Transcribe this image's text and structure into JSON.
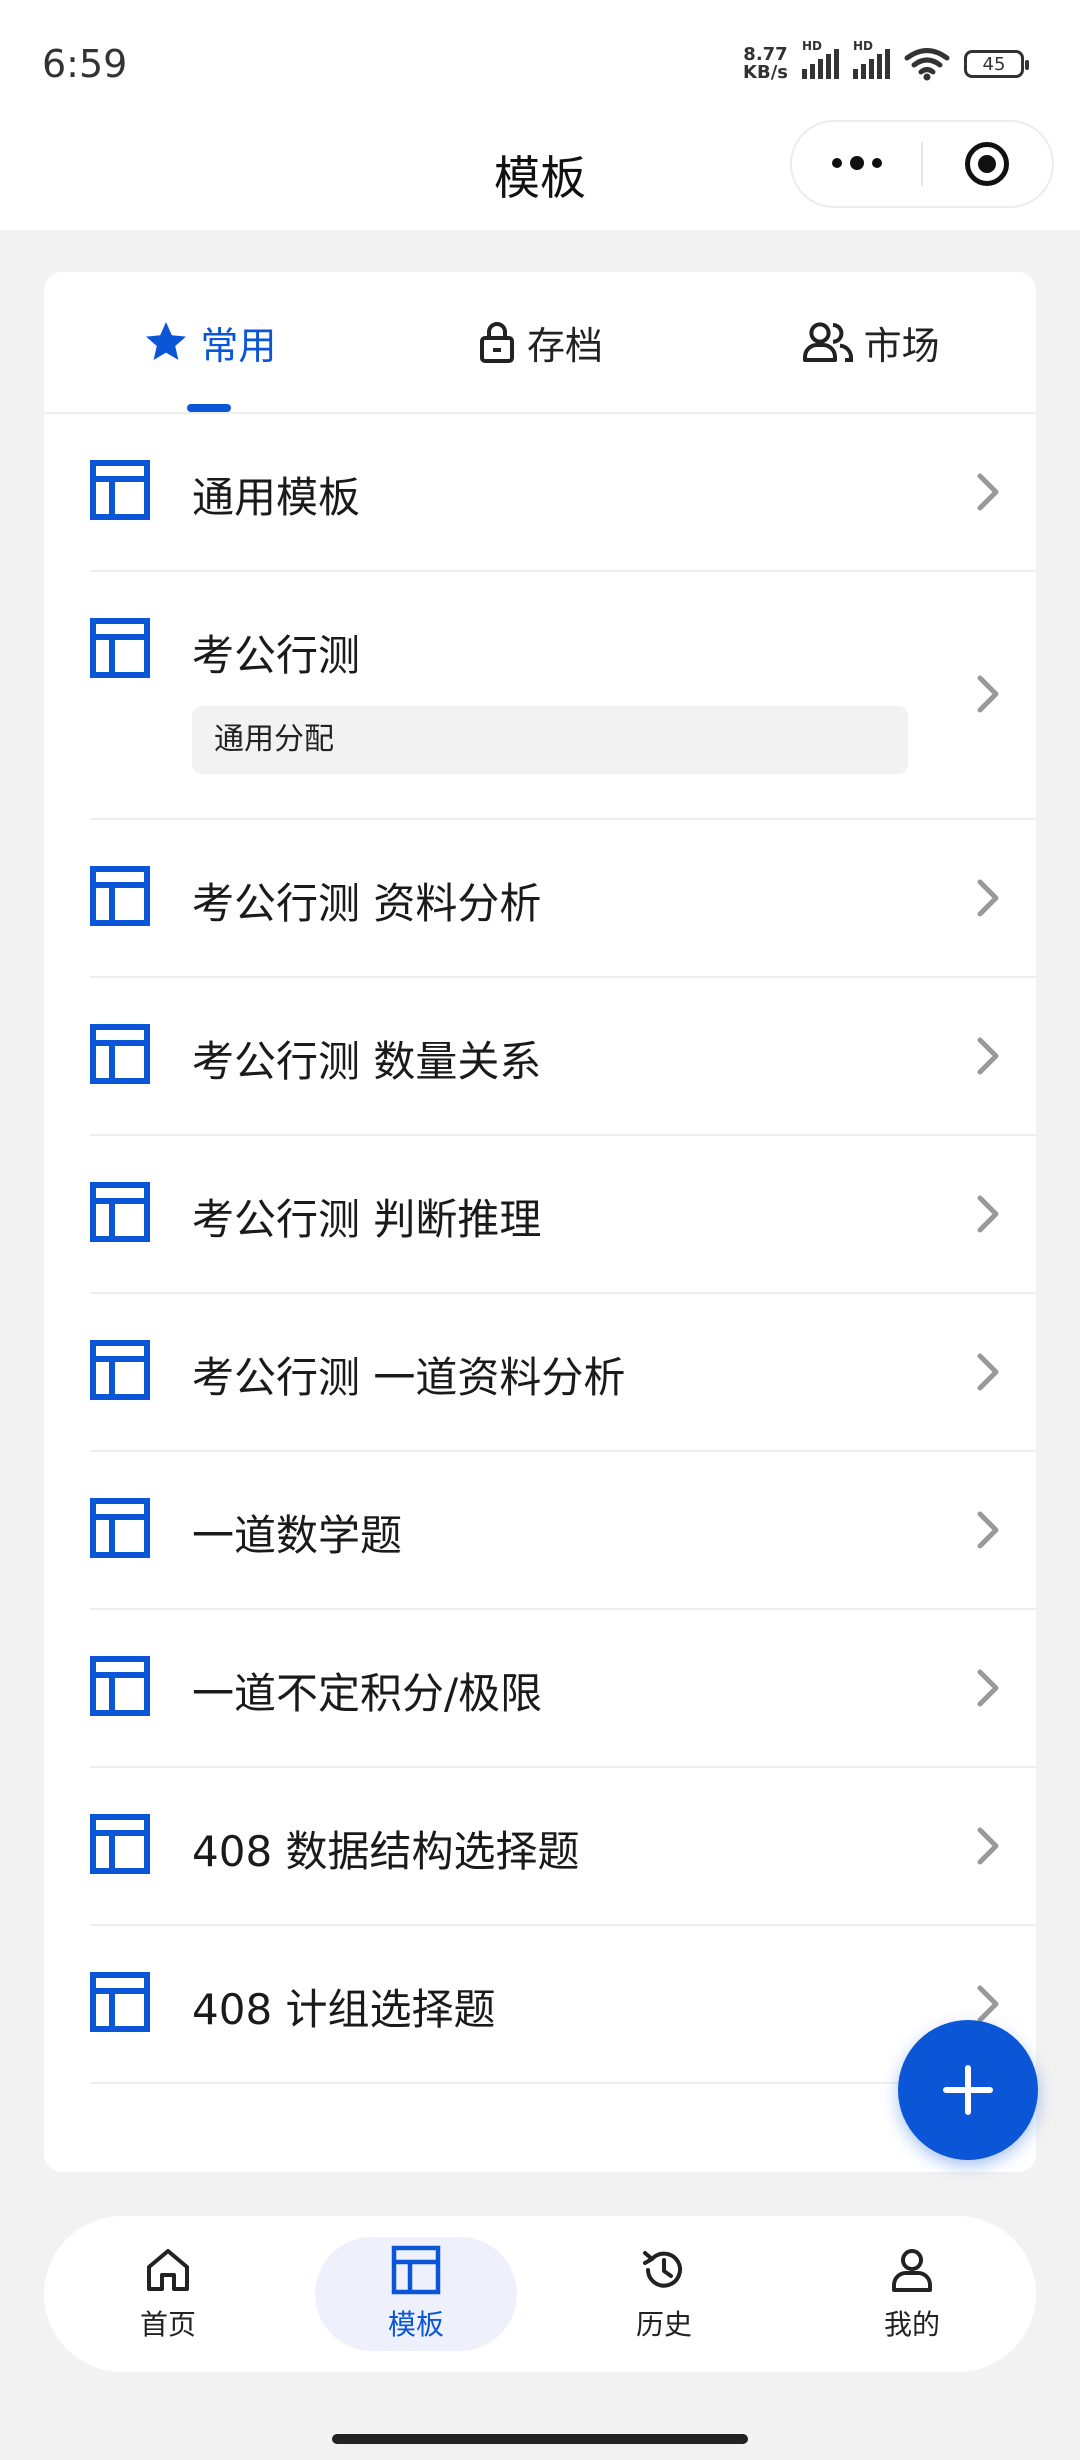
{
  "status_bar": {
    "time": "6:59",
    "net_speed_value": "8.77",
    "net_speed_unit": "KB/s",
    "hd": "HD",
    "battery": "45"
  },
  "nav": {
    "title": "模板"
  },
  "tabs": [
    {
      "label": "常用",
      "icon": "star-icon",
      "active": true
    },
    {
      "label": "存档",
      "icon": "lock-icon",
      "active": false
    },
    {
      "label": "市场",
      "icon": "people-icon",
      "active": false
    }
  ],
  "templates": [
    {
      "name": "通用模板"
    },
    {
      "name": "考公行测",
      "tag": "通用分配"
    },
    {
      "name": "考公行测 资料分析"
    },
    {
      "name": "考公行测 数量关系"
    },
    {
      "name": "考公行测 判断推理"
    },
    {
      "name": "考公行测 一道资料分析"
    },
    {
      "name": "一道数学题"
    },
    {
      "name": "一道不定积分/极限"
    },
    {
      "name": "408 数据结构选择题"
    },
    {
      "name": "408 计组选择题"
    }
  ],
  "tabbar": [
    {
      "label": "首页",
      "icon": "home-icon"
    },
    {
      "label": "模板",
      "icon": "template-icon",
      "active": true
    },
    {
      "label": "历史",
      "icon": "history-icon"
    },
    {
      "label": "我的",
      "icon": "user-icon"
    }
  ],
  "colors": {
    "accent": "#0a56d6",
    "background": "#f2f2f2"
  }
}
